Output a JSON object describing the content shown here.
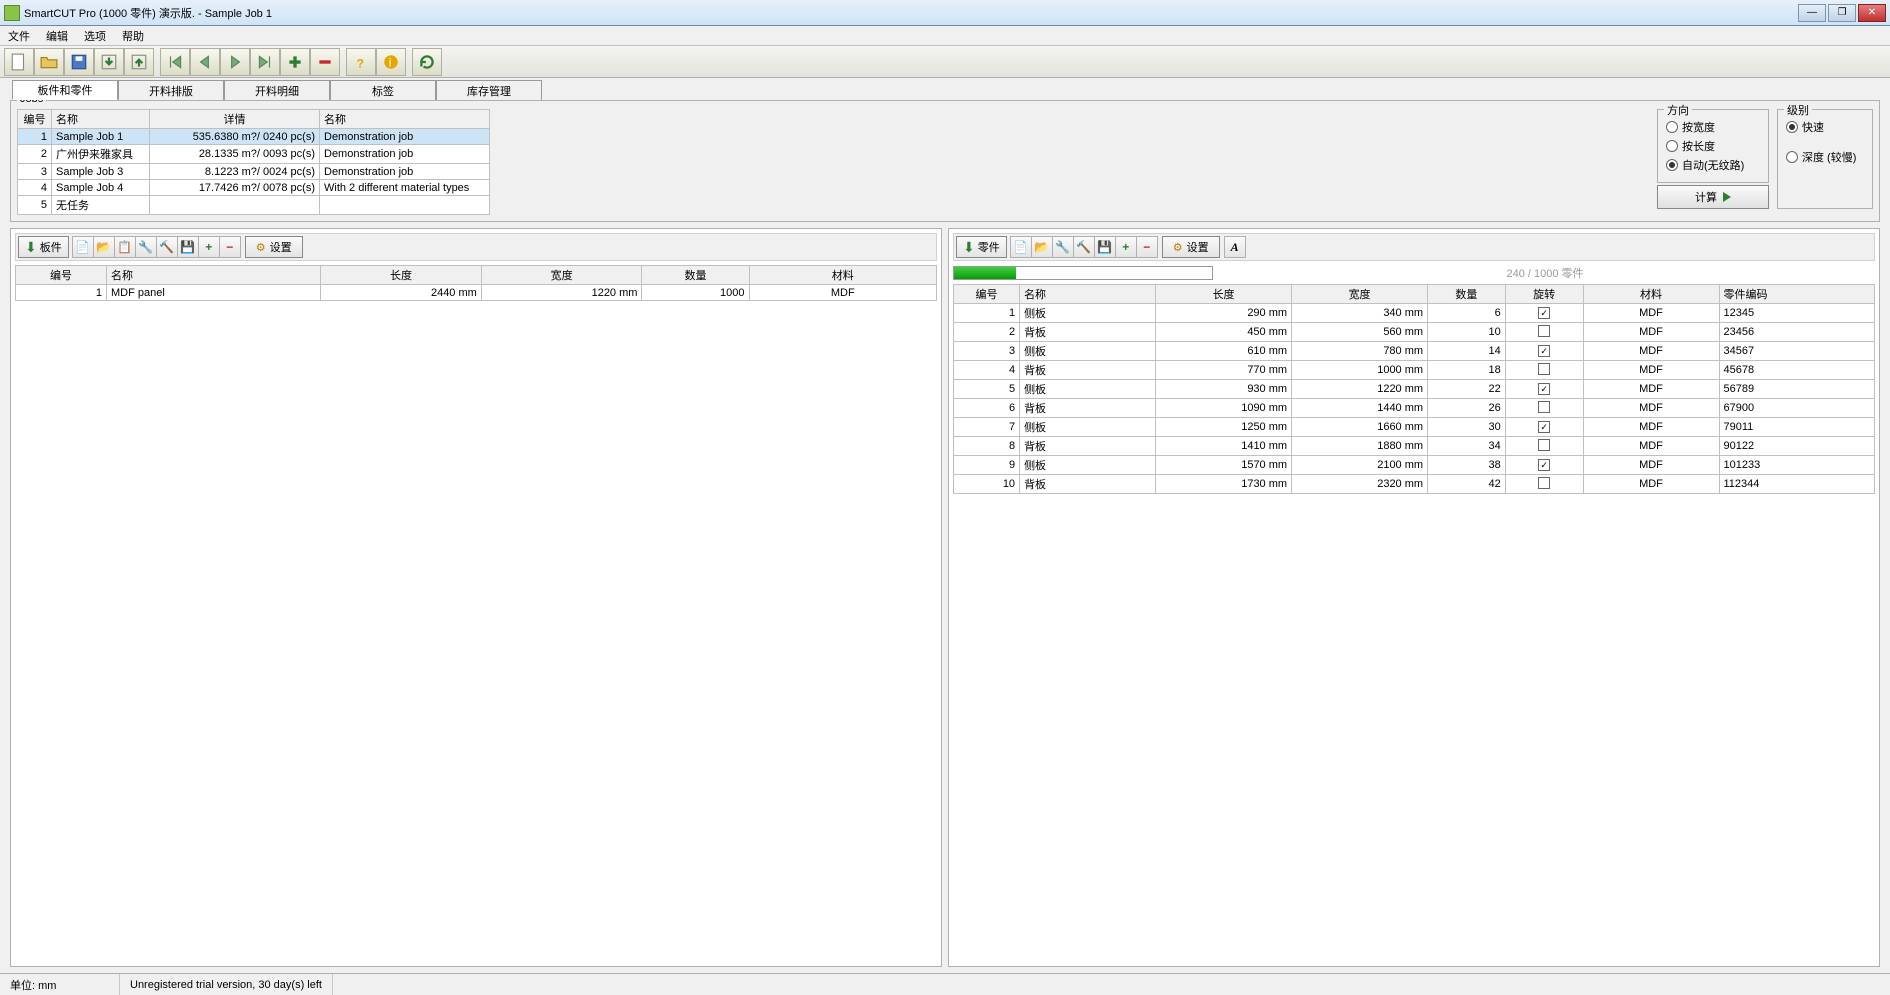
{
  "window": {
    "title": "SmartCUT Pro (1000 零件) 演示版. - Sample Job 1"
  },
  "menu": {
    "file": "文件",
    "edit": "编辑",
    "options": "选项",
    "help": "帮助"
  },
  "tabs": {
    "t1": "板件和零件",
    "t2": "开料排版",
    "t3": "开料明细",
    "t4": "标签",
    "t5": "库存管理"
  },
  "jobs": {
    "label": "Jobs",
    "headers": {
      "no": "编号",
      "name": "名称",
      "detail": "详情",
      "desc": "名称"
    },
    "rows": [
      {
        "no": "1",
        "name": "Sample Job 1",
        "detail": "535.6380 m?/ 0240 pc(s)",
        "desc": "Demonstration job"
      },
      {
        "no": "2",
        "name": "广州伊来雅家具",
        "detail": "28.1335 m?/ 0093 pc(s)",
        "desc": "Demonstration job"
      },
      {
        "no": "3",
        "name": "Sample Job 3",
        "detail": "8.1223 m?/ 0024 pc(s)",
        "desc": "Demonstration job"
      },
      {
        "no": "4",
        "name": "Sample Job 4",
        "detail": "17.7426 m?/ 0078 pc(s)",
        "desc": "With 2 different material types"
      },
      {
        "no": "5",
        "name": "无任务",
        "detail": "",
        "desc": ""
      }
    ]
  },
  "direction": {
    "legend": "方向",
    "byWidth": "按宽度",
    "byLength": "按长度",
    "auto": "自动(无纹路)"
  },
  "level": {
    "legend": "级别",
    "fast": "快速",
    "deep": "深度 (较慢)"
  },
  "calc": "计算",
  "panels": {
    "label": "板件",
    "settings": "设置",
    "headers": {
      "no": "编号",
      "name": "名称",
      "len": "长度",
      "wid": "宽度",
      "qty": "数量",
      "mat": "材料"
    },
    "rows": [
      {
        "no": "1",
        "name": "MDF panel",
        "len": "2440 mm",
        "wid": "1220 mm",
        "qty": "1000",
        "mat": "MDF"
      }
    ]
  },
  "parts": {
    "label": "零件",
    "settings": "设置",
    "progressText": "240 / 1000 零件",
    "progressPct": 24,
    "headers": {
      "no": "编号",
      "name": "名称",
      "len": "长度",
      "wid": "宽度",
      "qty": "数量",
      "rot": "旋转",
      "mat": "材料",
      "code": "零件编码"
    },
    "rows": [
      {
        "no": "1",
        "name": "侧板",
        "len": "290 mm",
        "wid": "340 mm",
        "qty": "6",
        "rot": true,
        "mat": "MDF",
        "code": "12345"
      },
      {
        "no": "2",
        "name": "背板",
        "len": "450 mm",
        "wid": "560 mm",
        "qty": "10",
        "rot": false,
        "mat": "MDF",
        "code": "23456"
      },
      {
        "no": "3",
        "name": "侧板",
        "len": "610 mm",
        "wid": "780 mm",
        "qty": "14",
        "rot": true,
        "mat": "MDF",
        "code": "34567"
      },
      {
        "no": "4",
        "name": "背板",
        "len": "770 mm",
        "wid": "1000 mm",
        "qty": "18",
        "rot": false,
        "mat": "MDF",
        "code": "45678"
      },
      {
        "no": "5",
        "name": "侧板",
        "len": "930 mm",
        "wid": "1220 mm",
        "qty": "22",
        "rot": true,
        "mat": "MDF",
        "code": "56789"
      },
      {
        "no": "6",
        "name": "背板",
        "len": "1090 mm",
        "wid": "1440 mm",
        "qty": "26",
        "rot": false,
        "mat": "MDF",
        "code": "67900"
      },
      {
        "no": "7",
        "name": "侧板",
        "len": "1250 mm",
        "wid": "1660 mm",
        "qty": "30",
        "rot": true,
        "mat": "MDF",
        "code": "79011"
      },
      {
        "no": "8",
        "name": "背板",
        "len": "1410 mm",
        "wid": "1880 mm",
        "qty": "34",
        "rot": false,
        "mat": "MDF",
        "code": "90122"
      },
      {
        "no": "9",
        "name": "侧板",
        "len": "1570 mm",
        "wid": "2100 mm",
        "qty": "38",
        "rot": true,
        "mat": "MDF",
        "code": "101233"
      },
      {
        "no": "10",
        "name": "背板",
        "len": "1730 mm",
        "wid": "2320 mm",
        "qty": "42",
        "rot": false,
        "mat": "MDF",
        "code": "112344"
      }
    ]
  },
  "status": {
    "unit": "单位: mm",
    "trial": "Unregistered trial version, 30 day(s) left"
  }
}
